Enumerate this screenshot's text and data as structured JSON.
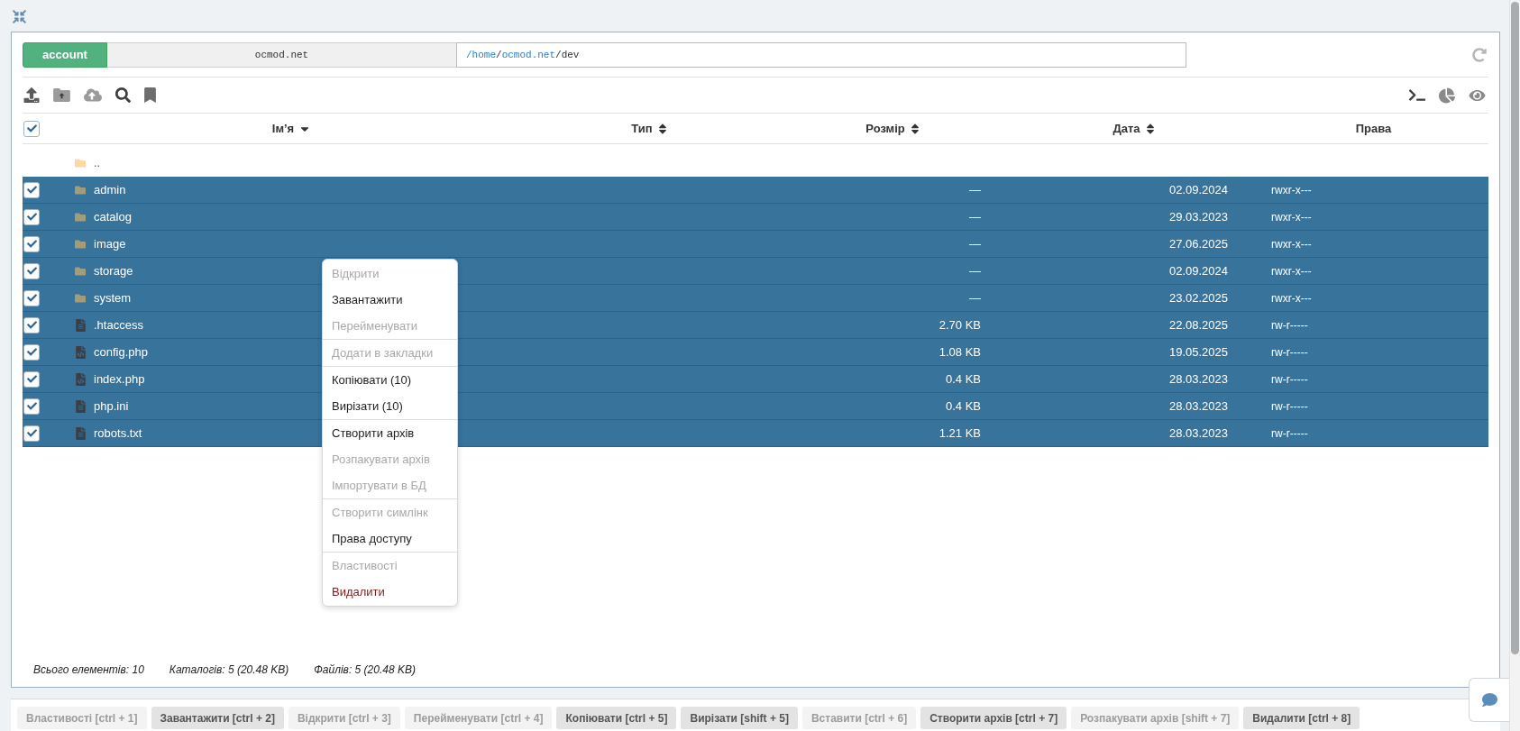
{
  "header": {
    "account_button": "account",
    "domain": "ocmod.net",
    "path": [
      {
        "text": "/home",
        "link": true
      },
      {
        "text": "/",
        "link": false
      },
      {
        "text": "ocmod.net",
        "link": true
      },
      {
        "text": "/dev",
        "link": false
      }
    ]
  },
  "table": {
    "select_all_checked": true,
    "columns": [
      {
        "label": "Ім’я",
        "sortable": true,
        "sorted": true
      },
      {
        "label": "Тип",
        "sortable": true,
        "sorted": false
      },
      {
        "label": "Розмір",
        "sortable": true,
        "sorted": false
      },
      {
        "label": "Дата",
        "sortable": true,
        "sorted": false
      },
      {
        "label": "Права",
        "sortable": false,
        "sorted": false
      }
    ],
    "parent_row": {
      "name": ".."
    },
    "rows": [
      {
        "name": "admin",
        "kind": "folder",
        "size": "—",
        "date": "02.09.2024",
        "permissions": "rwxr-x---",
        "checked": true,
        "selected": true
      },
      {
        "name": "catalog",
        "kind": "folder",
        "size": "—",
        "date": "29.03.2023",
        "permissions": "rwxr-x---",
        "checked": true,
        "selected": true
      },
      {
        "name": "image",
        "kind": "folder",
        "size": "—",
        "date": "27.06.2025",
        "permissions": "rwxr-x---",
        "checked": true,
        "selected": true
      },
      {
        "name": "storage",
        "kind": "folder",
        "size": "—",
        "date": "02.09.2024",
        "permissions": "rwxr-x---",
        "checked": true,
        "selected": true
      },
      {
        "name": "system",
        "kind": "folder",
        "size": "—",
        "date": "23.02.2025",
        "permissions": "rwxr-x---",
        "checked": true,
        "selected": true
      },
      {
        "name": ".htaccess",
        "kind": "text",
        "size": "2.70 KB",
        "date": "22.08.2025",
        "permissions": "rw-r-----",
        "checked": true,
        "selected": true
      },
      {
        "name": "config.php",
        "kind": "code",
        "size": "1.08 KB",
        "date": "19.05.2025",
        "permissions": "rw-r-----",
        "checked": true,
        "selected": true
      },
      {
        "name": "index.php",
        "kind": "code",
        "size": "0.4 KB",
        "date": "28.03.2023",
        "permissions": "rw-r-----",
        "checked": true,
        "selected": true
      },
      {
        "name": "php.ini",
        "kind": "text",
        "size": "0.4 KB",
        "date": "28.03.2023",
        "permissions": "rw-r-----",
        "checked": true,
        "selected": true
      },
      {
        "name": "robots.txt",
        "kind": "text",
        "size": "1.21 KB",
        "date": "28.03.2023",
        "permissions": "rw-r-----",
        "checked": true,
        "selected": true
      }
    ]
  },
  "context_menu": {
    "groups": [
      {
        "items": [
          {
            "label": "Відкрити",
            "disabled": true,
            "danger": false
          },
          {
            "label": "Завантажити",
            "disabled": false,
            "danger": false
          },
          {
            "label": "Перейменувати",
            "disabled": true,
            "danger": false
          }
        ]
      },
      {
        "items": [
          {
            "label": "Додати в закладки",
            "disabled": true,
            "danger": false
          }
        ]
      },
      {
        "items": [
          {
            "label": "Копіювати (10)",
            "disabled": false,
            "danger": false
          },
          {
            "label": "Вирізати (10)",
            "disabled": false,
            "danger": false
          }
        ]
      },
      {
        "items": [
          {
            "label": "Створити архів",
            "disabled": false,
            "danger": false
          },
          {
            "label": "Розпакувати архів",
            "disabled": true,
            "danger": false
          },
          {
            "label": "Імпортувати в БД",
            "disabled": true,
            "danger": false
          }
        ]
      },
      {
        "items": [
          {
            "label": "Створити симлінк",
            "disabled": true,
            "danger": false
          },
          {
            "label": "Права доступу",
            "disabled": false,
            "danger": false
          }
        ]
      },
      {
        "items": [
          {
            "label": "Властивості",
            "disabled": true,
            "danger": false
          },
          {
            "label": "Видалити",
            "disabled": false,
            "danger": true
          }
        ]
      }
    ]
  },
  "summary": [
    "Всього елементів: 10",
    "Каталогів: 5 (20.48 KB)",
    "Файлів: 5 (20.48 KB)"
  ],
  "action_buttons": [
    {
      "label": "Властивості [ctrl + 1]",
      "disabled": true
    },
    {
      "label": "Завантажити [ctrl + 2]",
      "disabled": false
    },
    {
      "label": "Відкрити [ctrl + 3]",
      "disabled": true
    },
    {
      "label": "Перейменувати [ctrl + 4]",
      "disabled": true
    },
    {
      "label": "Копіювати [ctrl + 5]",
      "disabled": false
    },
    {
      "label": "Вирізати [shift + 5]",
      "disabled": false
    },
    {
      "label": "Вставити [ctrl + 6]",
      "disabled": true
    },
    {
      "label": "Створити архів [ctrl + 7]",
      "disabled": false
    },
    {
      "label": "Розпакувати архів [shift + 7]",
      "disabled": true
    },
    {
      "label": "Видалити [ctrl + 8]",
      "disabled": false
    }
  ]
}
